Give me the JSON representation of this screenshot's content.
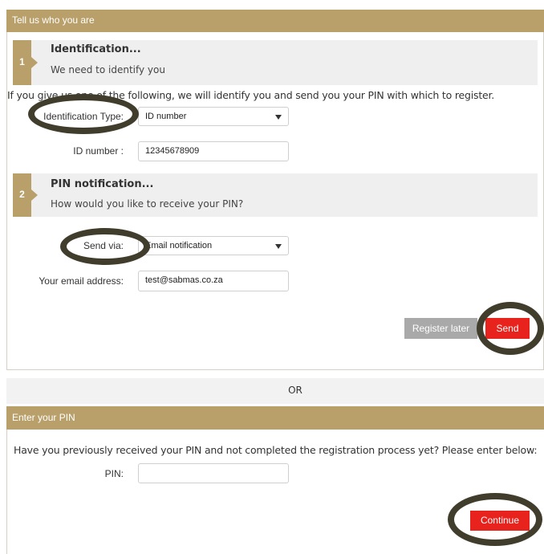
{
  "register": {
    "header": "Tell us who you are",
    "step1": {
      "number": "1",
      "title": "Identification...",
      "subtitle": "We need to identify you"
    },
    "intro_text": "If you give us one of the following, we will identify you and send you your PIN with which to register.",
    "id_type_label": "Identification Type:",
    "id_type_value": "ID number",
    "id_number_label": "ID number :",
    "id_number_value": "12345678909",
    "step2": {
      "number": "2",
      "title": "PIN notification...",
      "subtitle": "How would you like to receive your PIN?"
    },
    "send_via_label": "Send via:",
    "send_via_value": "Email notification",
    "email_label": "Your email address:",
    "email_value": "test@sabmas.co.za",
    "register_later_label": "Register later",
    "send_label": "Send"
  },
  "or_text": "OR",
  "pin": {
    "header": "Enter your PIN",
    "description": "Have you previously received your PIN and not completed the registration process yet? Please enter below:",
    "pin_label": "PIN:",
    "pin_value": "",
    "continue_label": "Continue"
  },
  "colors": {
    "header_gold": "#b9a06a",
    "button_red": "#e8221c",
    "button_grey": "#aaa9a9",
    "highlight_ring": "#413d2c"
  }
}
